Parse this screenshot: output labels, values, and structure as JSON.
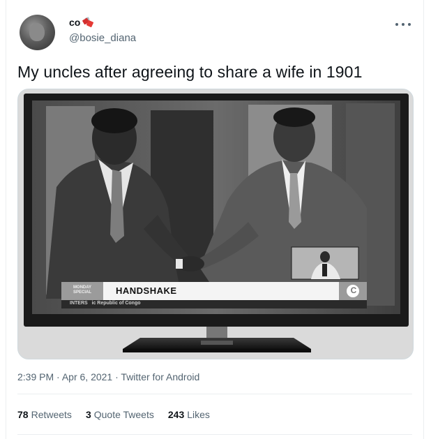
{
  "author": {
    "display_name": "co",
    "handle": "@bosie_diana"
  },
  "tweet": {
    "text": "My uncles after agreeing to share a wife in 1901",
    "media": {
      "banner_tag": "MONDAY SPECIAL",
      "banner_title": "HANDSHAKE",
      "ticker": "INTERS   ic Republic of Congo",
      "channel_logo": "C"
    },
    "time": "2:39 PM",
    "date": "Apr 6, 2021",
    "source": "Twitter for Android",
    "separator": "·"
  },
  "stats": {
    "retweets_count": "78",
    "retweets_label": "Retweets",
    "quotes_count": "3",
    "quotes_label": "Quote Tweets",
    "likes_count": "243",
    "likes_label": "Likes"
  }
}
